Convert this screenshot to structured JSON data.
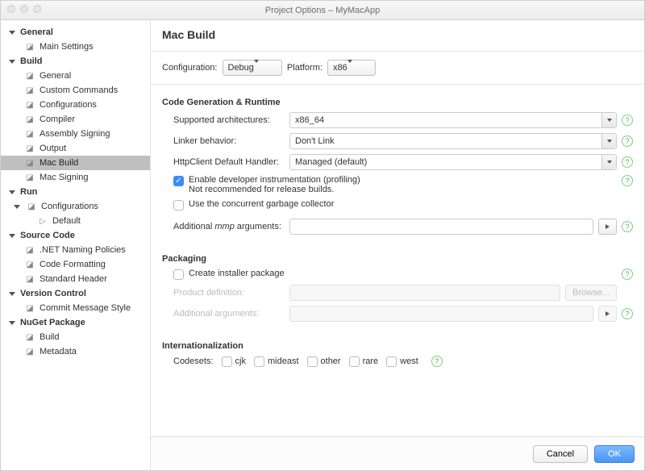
{
  "window_title": "Project Options – MyMacApp",
  "sidebar": {
    "groups": [
      {
        "label": "General",
        "items": [
          {
            "label": "Main Settings",
            "icon": "gear-icon"
          }
        ]
      },
      {
        "label": "Build",
        "items": [
          {
            "label": "General",
            "icon": "play-icon"
          },
          {
            "label": "Custom Commands",
            "icon": "play-icon"
          },
          {
            "label": "Configurations",
            "icon": "box-icon"
          },
          {
            "label": "Compiler",
            "icon": "compiler-icon"
          },
          {
            "label": "Assembly Signing",
            "icon": "sign-icon"
          },
          {
            "label": "Output",
            "icon": "output-icon"
          },
          {
            "label": "Mac Build",
            "icon": "monitor-icon",
            "selected": true
          },
          {
            "label": "Mac Signing",
            "icon": "monitor-icon"
          }
        ]
      },
      {
        "label": "Run",
        "items": [
          {
            "label": "Configurations",
            "icon": "gear-icon",
            "expandable": true,
            "children": [
              {
                "label": "Default",
                "icon": "play-icon"
              }
            ]
          }
        ]
      },
      {
        "label": "Source Code",
        "items": [
          {
            "label": ".NET Naming Policies",
            "icon": "page-icon"
          },
          {
            "label": "Code Formatting",
            "icon": "format-icon"
          },
          {
            "label": "Standard Header",
            "icon": "page-icon"
          }
        ]
      },
      {
        "label": "Version Control",
        "items": [
          {
            "label": "Commit Message Style",
            "icon": "gear-icon"
          }
        ]
      },
      {
        "label": "NuGet Package",
        "items": [
          {
            "label": "Build",
            "icon": "gear-icon"
          },
          {
            "label": "Metadata",
            "icon": "page-icon"
          }
        ]
      }
    ]
  },
  "page": {
    "title": "Mac Build",
    "config_label": "Configuration:",
    "config_value": "Debug",
    "platform_label": "Platform:",
    "platform_value": "x86"
  },
  "codegen": {
    "title": "Code Generation & Runtime",
    "arch_label": "Supported architectures:",
    "arch_value": "x86_64",
    "linker_label": "Linker behavior:",
    "linker_value": "Don't Link",
    "http_label": "HttpClient Default Handler:",
    "http_value": "Managed (default)",
    "profiling_label": "Enable developer instrumentation (profiling)",
    "profiling_sub": "Not recommended for release builds.",
    "gc_label": "Use the concurrent garbage collector",
    "mmp_label_a": "Additional ",
    "mmp_label_i": "mmp",
    "mmp_label_b": " arguments:"
  },
  "packaging": {
    "title": "Packaging",
    "installer_label": "Create installer package",
    "prod_label": "Product definition:",
    "browse_label": "Browse...",
    "addl_label": "Additional arguments:"
  },
  "i18n": {
    "title": "Internationalization",
    "codesets_label": "Codesets:",
    "sets": [
      "cjk",
      "mideast",
      "other",
      "rare",
      "west"
    ]
  },
  "footer": {
    "cancel": "Cancel",
    "ok": "OK"
  }
}
